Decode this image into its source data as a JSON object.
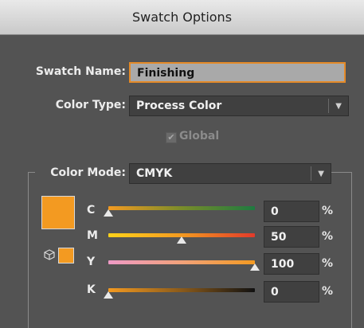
{
  "window": {
    "title": "Swatch Options"
  },
  "swatch_name": {
    "label": "Swatch Name:",
    "value": "Finishing"
  },
  "color_type": {
    "label": "Color Type:",
    "selected": "Process Color"
  },
  "global": {
    "label": "Global",
    "checked": true,
    "enabled": false
  },
  "color_mode": {
    "label": "Color Mode:",
    "selected": "CMYK"
  },
  "colors": {
    "swatch": "#f39a21",
    "accent": "#e48a28"
  },
  "icons": {
    "dropdown": "chevron-down-icon",
    "out_of_web_gamut": "cube-icon"
  },
  "channels": [
    {
      "label": "C",
      "value": "0",
      "unit": "%",
      "fraction": 0.0
    },
    {
      "label": "M",
      "value": "50",
      "unit": "%",
      "fraction": 0.5
    },
    {
      "label": "Y",
      "value": "100",
      "unit": "%",
      "fraction": 1.0
    },
    {
      "label": "K",
      "value": "0",
      "unit": "%",
      "fraction": 0.0
    }
  ]
}
